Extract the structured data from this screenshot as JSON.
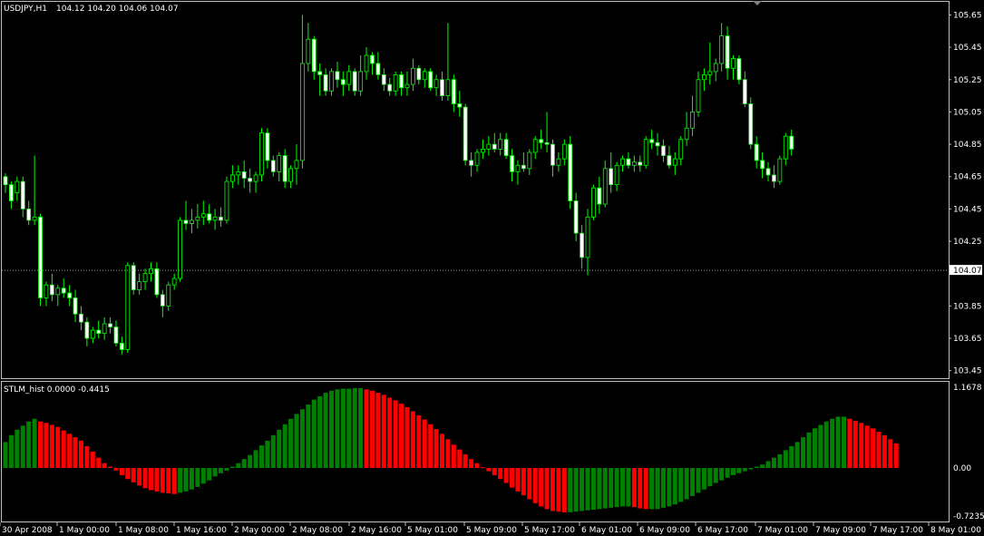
{
  "header": {
    "symbol": "USDJPY,H1",
    "ohlc": "104.12 104.20 104.06 104.07"
  },
  "colors": {
    "background": "#000000",
    "axis": "#c0c0c0",
    "candle_line": "#00ff00",
    "bull_body": "#000000",
    "bear_body": "#ffffff",
    "bid_line": "#a0a0a0",
    "hist_up": "#008000",
    "hist_down": "#ff0000"
  },
  "price_ticks": [
    "105.65",
    "105.45",
    "105.25",
    "105.05",
    "104.85",
    "104.65",
    "104.45",
    "104.25",
    "103.85",
    "103.65",
    "103.45"
  ],
  "current_price": "104.07",
  "indicator": {
    "title": "STLM_hist 0.0000 -0.4415",
    "ticks": [
      "1.1678",
      "0.00",
      "-0.7235"
    ]
  },
  "time_labels": [
    "30 Apr 2008",
    "1 May 00:00",
    "1 May 08:00",
    "1 May 16:00",
    "2 May 00:00",
    "2 May 08:00",
    "2 May 16:00",
    "5 May 01:00",
    "5 May 09:00",
    "5 May 17:00",
    "6 May 01:00",
    "6 May 09:00",
    "6 May 17:00",
    "7 May 01:00",
    "7 May 09:00",
    "7 May 17:00",
    "8 May 01:00"
  ],
  "chart_data": [
    {
      "type": "candlestick",
      "title": "USDJPY,H1",
      "ylim": [
        103.42,
        105.72
      ],
      "series": [
        {
          "name": "USDJPY,H1",
          "ohlc": [
            [
              104.65,
              104.67,
              104.55,
              104.6
            ],
            [
              104.6,
              104.62,
              104.45,
              104.5
            ],
            [
              104.55,
              104.65,
              104.5,
              104.62
            ],
            [
              104.62,
              104.65,
              104.4,
              104.45
            ],
            [
              104.45,
              104.5,
              104.35,
              104.38
            ],
            [
              104.38,
              104.78,
              104.35,
              104.4
            ],
            [
              104.4,
              104.42,
              103.85,
              103.9
            ],
            [
              103.9,
              104.0,
              103.85,
              103.98
            ],
            [
              103.98,
              104.05,
              103.88,
              103.92
            ],
            [
              103.92,
              103.98,
              103.85,
              103.96
            ],
            [
              103.96,
              104.02,
              103.9,
              103.93
            ],
            [
              103.93,
              103.98,
              103.85,
              103.9
            ],
            [
              103.9,
              103.95,
              103.75,
              103.8
            ],
            [
              103.8,
              103.85,
              103.7,
              103.75
            ],
            [
              103.75,
              103.78,
              103.6,
              103.65
            ],
            [
              103.65,
              103.72,
              103.62,
              103.7
            ],
            [
              103.7,
              103.76,
              103.65,
              103.68
            ],
            [
              103.68,
              103.78,
              103.64,
              103.74
            ],
            [
              103.74,
              103.78,
              103.68,
              103.72
            ],
            [
              103.72,
              103.76,
              103.6,
              103.62
            ],
            [
              103.62,
              103.66,
              103.55,
              103.58
            ],
            [
              103.58,
              104.12,
              103.56,
              104.1
            ],
            [
              104.1,
              104.12,
              103.92,
              103.95
            ],
            [
              103.95,
              104.05,
              103.92,
              104.0
            ],
            [
              104.0,
              104.08,
              103.95,
              104.05
            ],
            [
              104.05,
              104.12,
              104.0,
              104.08
            ],
            [
              104.08,
              104.12,
              103.9,
              103.92
            ],
            [
              103.92,
              103.95,
              103.78,
              103.85
            ],
            [
              103.85,
              104.0,
              103.82,
              103.98
            ],
            [
              103.98,
              104.05,
              103.95,
              104.02
            ],
            [
              104.02,
              104.4,
              104.0,
              104.38
            ],
            [
              104.38,
              104.5,
              104.32,
              104.36
            ],
            [
              104.36,
              104.45,
              104.3,
              104.38
            ],
            [
              104.38,
              104.48,
              104.33,
              104.4
            ],
            [
              104.4,
              104.5,
              104.35,
              104.42
            ],
            [
              104.42,
              104.48,
              104.36,
              104.38
            ],
            [
              104.38,
              104.45,
              104.32,
              104.4
            ],
            [
              104.4,
              104.46,
              104.34,
              104.38
            ],
            [
              104.38,
              104.65,
              104.36,
              104.62
            ],
            [
              104.62,
              104.72,
              104.58,
              104.66
            ],
            [
              104.66,
              104.72,
              104.6,
              104.68
            ],
            [
              104.68,
              104.75,
              104.58,
              104.64
            ],
            [
              104.64,
              104.7,
              104.55,
              104.62
            ],
            [
              104.62,
              104.68,
              104.55,
              104.66
            ],
            [
              104.66,
              104.95,
              104.62,
              104.92
            ],
            [
              104.92,
              104.95,
              104.7,
              104.75
            ],
            [
              104.75,
              104.78,
              104.65,
              104.68
            ],
            [
              104.68,
              104.8,
              104.62,
              104.78
            ],
            [
              104.78,
              104.82,
              104.58,
              104.62
            ],
            [
              104.62,
              104.72,
              104.58,
              104.7
            ],
            [
              104.7,
              104.85,
              104.6,
              104.75
            ],
            [
              104.75,
              105.65,
              104.7,
              105.35
            ],
            [
              105.35,
              105.6,
              105.3,
              105.5
            ],
            [
              105.5,
              105.52,
              105.25,
              105.3
            ],
            [
              105.3,
              105.35,
              105.15,
              105.28
            ],
            [
              105.28,
              105.32,
              105.15,
              105.18
            ],
            [
              105.18,
              105.32,
              105.15,
              105.3
            ],
            [
              105.3,
              105.36,
              105.2,
              105.25
            ],
            [
              105.25,
              105.3,
              105.15,
              105.22
            ],
            [
              105.22,
              105.34,
              105.18,
              105.3
            ],
            [
              105.3,
              105.32,
              105.15,
              105.18
            ],
            [
              105.18,
              105.4,
              105.15,
              105.3
            ],
            [
              105.3,
              105.45,
              105.25,
              105.4
            ],
            [
              105.4,
              105.42,
              105.28,
              105.35
            ],
            [
              105.35,
              105.42,
              105.25,
              105.28
            ],
            [
              105.28,
              105.32,
              105.18,
              105.22
            ],
            [
              105.22,
              105.26,
              105.15,
              105.18
            ],
            [
              105.18,
              105.3,
              105.15,
              105.28
            ],
            [
              105.28,
              105.3,
              105.15,
              105.2
            ],
            [
              105.2,
              105.3,
              105.15,
              105.22
            ],
            [
              105.22,
              105.38,
              105.18,
              105.32
            ],
            [
              105.32,
              105.34,
              105.22,
              105.25
            ],
            [
              105.25,
              105.32,
              105.2,
              105.3
            ],
            [
              105.3,
              105.32,
              105.18,
              105.2
            ],
            [
              105.2,
              105.28,
              105.15,
              105.25
            ],
            [
              105.25,
              105.3,
              105.12,
              105.15
            ],
            [
              105.15,
              105.6,
              105.12,
              105.25
            ],
            [
              105.25,
              105.28,
              105.05,
              105.1
            ],
            [
              105.1,
              105.18,
              105.02,
              105.08
            ],
            [
              105.08,
              105.1,
              104.72,
              104.75
            ],
            [
              104.75,
              104.8,
              104.65,
              104.72
            ],
            [
              104.72,
              104.82,
              104.68,
              104.8
            ],
            [
              104.8,
              104.88,
              104.76,
              104.82
            ],
            [
              104.82,
              104.9,
              104.78,
              104.85
            ],
            [
              104.85,
              104.92,
              104.8,
              104.82
            ],
            [
              104.82,
              104.92,
              104.78,
              104.88
            ],
            [
              104.88,
              104.92,
              104.76,
              104.78
            ],
            [
              104.78,
              104.82,
              104.62,
              104.68
            ],
            [
              104.68,
              104.75,
              104.6,
              104.72
            ],
            [
              104.72,
              104.8,
              104.68,
              104.7
            ],
            [
              104.7,
              104.82,
              104.66,
              104.8
            ],
            [
              104.8,
              104.9,
              104.76,
              104.88
            ],
            [
              104.88,
              104.94,
              104.82,
              104.86
            ],
            [
              104.86,
              105.05,
              104.8,
              104.85
            ],
            [
              104.85,
              104.88,
              104.65,
              104.72
            ],
            [
              104.72,
              104.8,
              104.68,
              104.76
            ],
            [
              104.76,
              104.88,
              104.72,
              104.85
            ],
            [
              104.85,
              104.9,
              104.45,
              104.5
            ],
            [
              104.5,
              104.55,
              104.25,
              104.3
            ],
            [
              104.3,
              104.35,
              104.08,
              104.15
            ],
            [
              104.15,
              104.45,
              104.04,
              104.4
            ],
            [
              104.4,
              104.6,
              104.38,
              104.58
            ],
            [
              104.58,
              104.65,
              104.42,
              104.48
            ],
            [
              104.48,
              104.75,
              104.46,
              104.7
            ],
            [
              104.7,
              104.8,
              104.55,
              104.6
            ],
            [
              104.6,
              104.74,
              104.56,
              104.72
            ],
            [
              104.72,
              104.78,
              104.68,
              104.76
            ],
            [
              104.76,
              104.8,
              104.7,
              104.72
            ],
            [
              104.72,
              104.78,
              104.68,
              104.74
            ],
            [
              104.74,
              104.78,
              104.68,
              104.72
            ],
            [
              104.72,
              104.9,
              104.7,
              104.88
            ],
            [
              104.88,
              104.94,
              104.82,
              104.86
            ],
            [
              104.86,
              104.92,
              104.78,
              104.84
            ],
            [
              104.84,
              104.88,
              104.74,
              104.78
            ],
            [
              104.78,
              104.84,
              104.7,
              104.72
            ],
            [
              104.72,
              104.8,
              104.66,
              104.76
            ],
            [
              104.76,
              104.9,
              104.72,
              104.88
            ],
            [
              104.88,
              105.05,
              104.84,
              104.95
            ],
            [
              104.95,
              105.15,
              104.9,
              105.05
            ],
            [
              105.05,
              105.3,
              105.02,
              105.25
            ],
            [
              105.25,
              105.32,
              105.18,
              105.28
            ],
            [
              105.28,
              105.48,
              105.22,
              105.3
            ],
            [
              105.3,
              105.38,
              105.24,
              105.35
            ],
            [
              105.35,
              105.6,
              105.3,
              105.52
            ],
            [
              105.52,
              105.58,
              105.25,
              105.32
            ],
            [
              105.32,
              105.4,
              105.25,
              105.38
            ],
            [
              105.38,
              105.4,
              105.22,
              105.25
            ],
            [
              105.25,
              105.3,
              105.08,
              105.1
            ],
            [
              105.1,
              105.14,
              104.82,
              104.85
            ],
            [
              104.85,
              104.9,
              104.7,
              104.75
            ],
            [
              104.75,
              104.8,
              104.64,
              104.7
            ],
            [
              104.7,
              104.74,
              104.62,
              104.66
            ],
            [
              104.66,
              104.72,
              104.58,
              104.62
            ],
            [
              104.62,
              104.78,
              104.6,
              104.76
            ],
            [
              104.76,
              104.92,
              104.72,
              104.9
            ],
            [
              104.9,
              104.94,
              104.78,
              104.82
            ]
          ]
        }
      ]
    },
    {
      "type": "bar",
      "title": "STLM_hist 0.0000 -0.4415",
      "ylim": [
        -0.7235,
        1.1678
      ],
      "series": [
        {
          "name": "STLM_hist",
          "values": [
            0.38,
            0.48,
            0.56,
            0.62,
            0.68,
            0.72,
            0.68,
            0.66,
            0.63,
            0.6,
            0.55,
            0.5,
            0.45,
            0.4,
            0.32,
            0.24,
            0.15,
            0.07,
            0.02,
            -0.04,
            -0.11,
            -0.17,
            -0.22,
            -0.27,
            -0.31,
            -0.34,
            -0.36,
            -0.38,
            -0.39,
            -0.4,
            -0.38,
            -0.36,
            -0.33,
            -0.29,
            -0.24,
            -0.19,
            -0.13,
            -0.08,
            -0.04,
            0.02,
            0.07,
            0.13,
            0.19,
            0.26,
            0.33,
            0.4,
            0.48,
            0.56,
            0.64,
            0.72,
            0.79,
            0.86,
            0.93,
            1.0,
            1.05,
            1.1,
            1.13,
            1.15,
            1.16,
            1.16,
            1.17,
            1.17,
            1.15,
            1.13,
            1.1,
            1.07,
            1.03,
            0.99,
            0.94,
            0.89,
            0.83,
            0.77,
            0.71,
            0.64,
            0.57,
            0.5,
            0.42,
            0.34,
            0.27,
            0.2,
            0.13,
            0.07,
            0.01,
            -0.05,
            -0.11,
            -0.17,
            -0.23,
            -0.3,
            -0.36,
            -0.42,
            -0.48,
            -0.54,
            -0.59,
            -0.63,
            -0.66,
            -0.67,
            -0.68,
            -0.68,
            -0.67,
            -0.66,
            -0.65,
            -0.64,
            -0.63,
            -0.62,
            -0.61,
            -0.6,
            -0.59,
            -0.59,
            -0.6,
            -0.62,
            -0.63,
            -0.63,
            -0.63,
            -0.61,
            -0.59,
            -0.56,
            -0.52,
            -0.48,
            -0.43,
            -0.38,
            -0.33,
            -0.28,
            -0.23,
            -0.19,
            -0.15,
            -0.11,
            -0.08,
            -0.05,
            -0.02,
            0.02,
            0.05,
            0.1,
            0.15,
            0.2,
            0.26,
            0.32,
            0.38,
            0.45,
            0.52,
            0.58,
            0.63,
            0.68,
            0.72,
            0.75,
            0.75,
            0.72,
            0.69,
            0.66,
            0.62,
            0.58,
            0.53,
            0.48,
            0.42,
            0.36
          ]
        }
      ]
    }
  ]
}
